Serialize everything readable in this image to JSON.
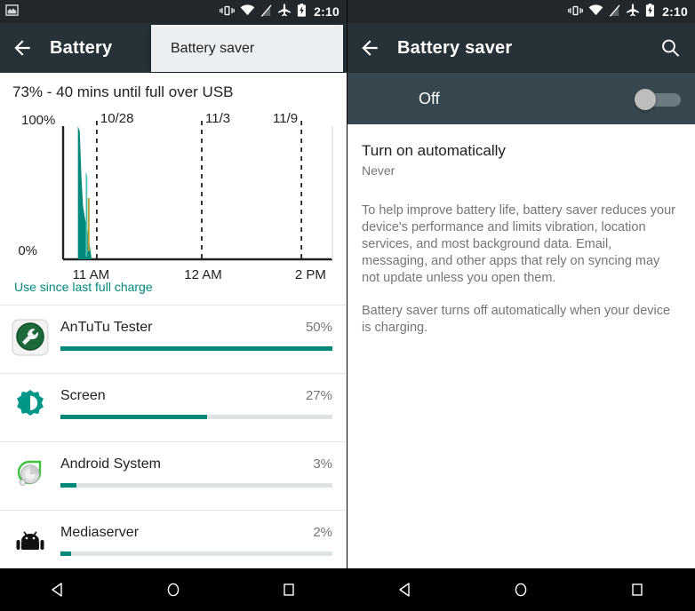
{
  "statusbar": {
    "time": "2:10",
    "icons": [
      "image-notification-icon",
      "vibrate-icon",
      "wifi-icon",
      "no-signal-icon",
      "airplane-mode-icon",
      "battery-charging-icon"
    ]
  },
  "left": {
    "title": "Battery",
    "back_icon": "back-arrow-icon",
    "overflow_menu": {
      "items": [
        "Battery saver"
      ]
    },
    "summary": "73% - 40 mins until full over USB",
    "use_since_label": "Use since last full charge",
    "apps": [
      {
        "name": "AnTuTu Tester",
        "percent": "50%",
        "value": 50,
        "icon": "antutu-icon"
      },
      {
        "name": "Screen",
        "percent": "27%",
        "value": 27,
        "icon": "brightness-icon"
      },
      {
        "name": "Android System",
        "percent": "3%",
        "value": 3,
        "icon": "android-system-icon"
      },
      {
        "name": "Mediaserver",
        "percent": "2%",
        "value": 2,
        "icon": "android-robot-icon"
      }
    ]
  },
  "right": {
    "title": "Battery saver",
    "back_icon": "back-arrow-icon",
    "search_icon": "search-icon",
    "toggle_label": "Off",
    "toggle_state": "off",
    "pref_title": "Turn on automatically",
    "pref_value": "Never",
    "paragraph1": "To help improve battery life, battery saver reduces your device's performance and limits vibration, location services, and most background data. Email, messaging, and other apps that rely on syncing may not update unless you open them.",
    "paragraph2": "Battery saver turns off automatically when your device is charging."
  },
  "navbar": {
    "back": "nav-back-icon",
    "home": "nav-home-icon",
    "recents": "nav-recents-icon"
  },
  "colors": {
    "accent": "#00897b",
    "actionbar": "#263238",
    "statusbar": "#21272b",
    "toggle_row": "#37474f",
    "link": "#00897b"
  },
  "chart_data": {
    "type": "area",
    "title": "Battery level history",
    "xlabel": "",
    "ylabel": "",
    "ylim": [
      0,
      100
    ],
    "ytick_labels": [
      "100%",
      "0%"
    ],
    "xtick_labels": [
      "11 AM",
      "12 AM",
      "2 PM"
    ],
    "xtick_positions": [
      0.055,
      0.52,
      0.95
    ],
    "date_markers": [
      {
        "label": "10/28",
        "position": 0.125
      },
      {
        "label": "11/3",
        "position": 0.515
      },
      {
        "label": "11/9",
        "position": 0.885
      }
    ],
    "grid": false,
    "series": [
      {
        "name": "Battery level",
        "color": "#00897b",
        "x": [
          0.055,
          0.062,
          0.068,
          0.074,
          0.082,
          0.09,
          0.098,
          0.106
        ],
        "y": [
          100,
          96,
          62,
          40,
          30,
          22,
          12,
          0
        ]
      },
      {
        "name": "Charging marker",
        "color": "#b3a13a",
        "x": [
          0.095,
          0.095
        ],
        "y": [
          46,
          6
        ]
      }
    ],
    "notes": "Nearly all battery history is compressed into a narrow spike at the left edge near 11 AM; remainder of plot area is empty."
  }
}
